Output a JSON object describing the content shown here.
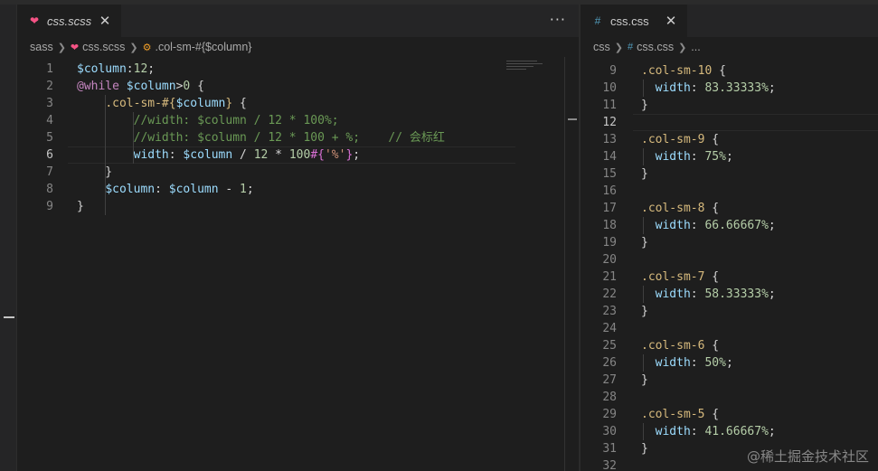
{
  "left_editor": {
    "tab": {
      "filename": "css.scss",
      "icon": "sass-file-icon",
      "icon_color": "#f55385"
    },
    "more_actions": "···",
    "breadcrumb": [
      {
        "label": "sass",
        "icon": ""
      },
      {
        "label": "css.scss",
        "icon": "sass-file-icon"
      },
      {
        "label": ".col-sm-#{$column}",
        "icon": "symbol-class-icon"
      }
    ],
    "active_line": 6,
    "lines": [
      {
        "n": "1",
        "tokens": [
          {
            "t": "$column",
            "c": "t-var"
          },
          {
            "t": ":",
            "c": "t-pun"
          },
          {
            "t": "12",
            "c": "t-num"
          },
          {
            "t": ";",
            "c": "t-pun"
          }
        ]
      },
      {
        "n": "2",
        "tokens": [
          {
            "t": "@while",
            "c": "t-kw"
          },
          {
            "t": " ",
            "c": "t-pun"
          },
          {
            "t": "$column",
            "c": "t-var"
          },
          {
            "t": ">",
            "c": "t-pun"
          },
          {
            "t": "0",
            "c": "t-num"
          },
          {
            "t": " {",
            "c": "t-pun"
          }
        ]
      },
      {
        "n": "3",
        "tokens": [
          {
            "t": "    ",
            "c": "t-pun"
          },
          {
            "t": ".col-sm-#{",
            "c": "t-sel"
          },
          {
            "t": "$column",
            "c": "t-var"
          },
          {
            "t": "}",
            "c": "t-sel"
          },
          {
            "t": " {",
            "c": "t-pun"
          }
        ]
      },
      {
        "n": "4",
        "tokens": [
          {
            "t": "        ",
            "c": "t-pun"
          },
          {
            "t": "//width: $column / 12 * 100%;",
            "c": "t-cm"
          }
        ]
      },
      {
        "n": "5",
        "tokens": [
          {
            "t": "        ",
            "c": "t-pun"
          },
          {
            "t": "//width: $column / 12 * 100 + %;    // 会标红",
            "c": "t-cm"
          }
        ]
      },
      {
        "n": "6",
        "tokens": [
          {
            "t": "        ",
            "c": "t-pun"
          },
          {
            "t": "width",
            "c": "t-prop"
          },
          {
            "t": ": ",
            "c": "t-pun"
          },
          {
            "t": "$column",
            "c": "t-var"
          },
          {
            "t": " / ",
            "c": "t-pun"
          },
          {
            "t": "12",
            "c": "t-num"
          },
          {
            "t": " * ",
            "c": "t-pun"
          },
          {
            "t": "100",
            "c": "t-num"
          },
          {
            "t": "#{",
            "c": "t-brk"
          },
          {
            "t": "'%'",
            "c": "t-str"
          },
          {
            "t": "}",
            "c": "t-brk"
          },
          {
            "t": ";",
            "c": "t-pun"
          }
        ]
      },
      {
        "n": "7",
        "tokens": [
          {
            "t": "    }",
            "c": "t-pun"
          }
        ]
      },
      {
        "n": "8",
        "tokens": [
          {
            "t": "    ",
            "c": "t-pun"
          },
          {
            "t": "$column",
            "c": "t-var"
          },
          {
            "t": ": ",
            "c": "t-pun"
          },
          {
            "t": "$column",
            "c": "t-var"
          },
          {
            "t": " - ",
            "c": "t-pun"
          },
          {
            "t": "1",
            "c": "t-num"
          },
          {
            "t": ";",
            "c": "t-pun"
          }
        ]
      },
      {
        "n": "9",
        "tokens": [
          {
            "t": "}",
            "c": "t-pun"
          }
        ]
      }
    ]
  },
  "right_editor": {
    "tab": {
      "filename": "css.css",
      "icon": "hash-icon",
      "icon_color": "#519aba"
    },
    "breadcrumb": [
      {
        "label": "css",
        "icon": ""
      },
      {
        "label": "css.css",
        "icon": "hash-icon"
      },
      {
        "label": "...",
        "icon": ""
      }
    ],
    "active_line": 12,
    "lines": [
      {
        "n": "9",
        "tokens": [
          {
            "t": ".col-sm-10",
            "c": "t-sel"
          },
          {
            "t": " {",
            "c": "t-pun"
          }
        ]
      },
      {
        "n": "10",
        "tokens": [
          {
            "t": "  ",
            "c": "t-pun"
          },
          {
            "t": "width",
            "c": "t-prop"
          },
          {
            "t": ": ",
            "c": "t-pun"
          },
          {
            "t": "83.33333%",
            "c": "t-num"
          },
          {
            "t": ";",
            "c": "t-pun"
          }
        ]
      },
      {
        "n": "11",
        "tokens": [
          {
            "t": "}",
            "c": "t-pun"
          }
        ]
      },
      {
        "n": "12",
        "tokens": []
      },
      {
        "n": "13",
        "tokens": [
          {
            "t": ".col-sm-9",
            "c": "t-sel"
          },
          {
            "t": " {",
            "c": "t-pun"
          }
        ]
      },
      {
        "n": "14",
        "tokens": [
          {
            "t": "  ",
            "c": "t-pun"
          },
          {
            "t": "width",
            "c": "t-prop"
          },
          {
            "t": ": ",
            "c": "t-pun"
          },
          {
            "t": "75%",
            "c": "t-num"
          },
          {
            "t": ";",
            "c": "t-pun"
          }
        ]
      },
      {
        "n": "15",
        "tokens": [
          {
            "t": "}",
            "c": "t-pun"
          }
        ]
      },
      {
        "n": "16",
        "tokens": []
      },
      {
        "n": "17",
        "tokens": [
          {
            "t": ".col-sm-8",
            "c": "t-sel"
          },
          {
            "t": " {",
            "c": "t-pun"
          }
        ]
      },
      {
        "n": "18",
        "tokens": [
          {
            "t": "  ",
            "c": "t-pun"
          },
          {
            "t": "width",
            "c": "t-prop"
          },
          {
            "t": ": ",
            "c": "t-pun"
          },
          {
            "t": "66.66667%",
            "c": "t-num"
          },
          {
            "t": ";",
            "c": "t-pun"
          }
        ]
      },
      {
        "n": "19",
        "tokens": [
          {
            "t": "}",
            "c": "t-pun"
          }
        ]
      },
      {
        "n": "20",
        "tokens": []
      },
      {
        "n": "21",
        "tokens": [
          {
            "t": ".col-sm-7",
            "c": "t-sel"
          },
          {
            "t": " {",
            "c": "t-pun"
          }
        ]
      },
      {
        "n": "22",
        "tokens": [
          {
            "t": "  ",
            "c": "t-pun"
          },
          {
            "t": "width",
            "c": "t-prop"
          },
          {
            "t": ": ",
            "c": "t-pun"
          },
          {
            "t": "58.33333%",
            "c": "t-num"
          },
          {
            "t": ";",
            "c": "t-pun"
          }
        ]
      },
      {
        "n": "23",
        "tokens": [
          {
            "t": "}",
            "c": "t-pun"
          }
        ]
      },
      {
        "n": "24",
        "tokens": []
      },
      {
        "n": "25",
        "tokens": [
          {
            "t": ".col-sm-6",
            "c": "t-sel"
          },
          {
            "t": " {",
            "c": "t-pun"
          }
        ]
      },
      {
        "n": "26",
        "tokens": [
          {
            "t": "  ",
            "c": "t-pun"
          },
          {
            "t": "width",
            "c": "t-prop"
          },
          {
            "t": ": ",
            "c": "t-pun"
          },
          {
            "t": "50%",
            "c": "t-num"
          },
          {
            "t": ";",
            "c": "t-pun"
          }
        ]
      },
      {
        "n": "27",
        "tokens": [
          {
            "t": "}",
            "c": "t-pun"
          }
        ]
      },
      {
        "n": "28",
        "tokens": []
      },
      {
        "n": "29",
        "tokens": [
          {
            "t": ".col-sm-5",
            "c": "t-sel"
          },
          {
            "t": " {",
            "c": "t-pun"
          }
        ]
      },
      {
        "n": "30",
        "tokens": [
          {
            "t": "  ",
            "c": "t-pun"
          },
          {
            "t": "width",
            "c": "t-prop"
          },
          {
            "t": ": ",
            "c": "t-pun"
          },
          {
            "t": "41.66667%",
            "c": "t-num"
          },
          {
            "t": ";",
            "c": "t-pun"
          }
        ]
      },
      {
        "n": "31",
        "tokens": [
          {
            "t": "}",
            "c": "t-pun"
          }
        ]
      },
      {
        "n": "32",
        "tokens": []
      }
    ]
  },
  "watermark": "@稀土掘金技术社区"
}
